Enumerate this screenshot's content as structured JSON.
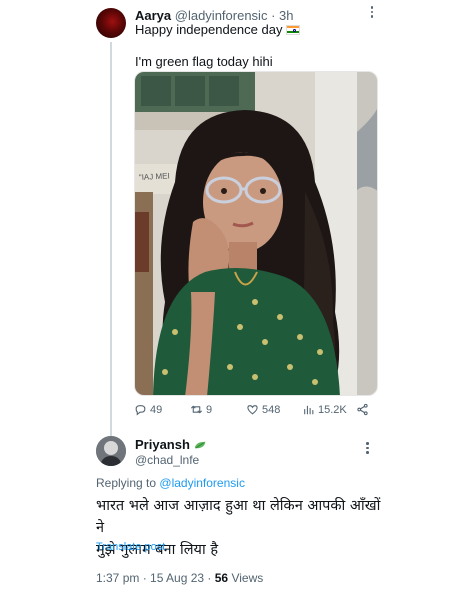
{
  "tweet": {
    "author_name": "Aarya",
    "author_handle": "@ladyinforensic",
    "separator": "·",
    "time_ago": "3h",
    "line1": "Happy independence day",
    "flag_emoji": "india-flag",
    "line2": "I'm green flag today hihi",
    "actions": {
      "replies": "49",
      "retweets": "9",
      "likes": "548",
      "views": "15.2K"
    },
    "colors": {
      "icon": "#536471",
      "text": "#0f1419"
    }
  },
  "reply": {
    "author_name": "Priyansh",
    "author_handle": "@chad_lnfe",
    "badge_icon": "leaf-icon",
    "replying_prefix": "Replying to",
    "replying_mention": "@ladyinforensic",
    "text_line1": "भारत भले आज आज़ाद हुआ था लेकिन आपकी आँखों ने",
    "text_line2": "मुझे गुलाम बना लिया है",
    "translate_label": "Translate post",
    "timestamp": "1:37 pm · 15 Aug 23 ·",
    "views_count": "56",
    "views_label": "Views",
    "colors": {
      "link": "#1d9bf0",
      "muted": "#536471"
    }
  }
}
